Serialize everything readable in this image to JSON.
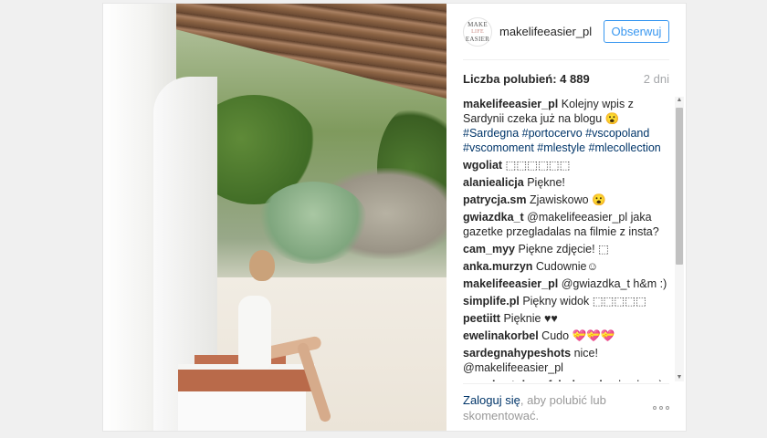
{
  "header": {
    "avatar_lines": [
      "MAKE",
      "LIFE",
      "EASIER"
    ],
    "username": "makelifeeasier_pl",
    "follow_label": "Obserwuj"
  },
  "stats": {
    "likes_label": "Liczba polubień: 4 889",
    "age": "2 dni"
  },
  "comments": [
    {
      "user": "makelifeeasier_pl",
      "text": "Kolejny wpis z Sardynii czeka już na blogu 😮 ",
      "tags": "#Sardegna #portocervo #vscopoland #vscomoment #mlestyle #mlecollection"
    },
    {
      "user": "wgoliat",
      "text": "⬚⬚⬚⬚⬚⬚"
    },
    {
      "user": "alaniealicja",
      "text": "Piękne!"
    },
    {
      "user": "patrycja.sm",
      "text": "Zjawiskowo 😮"
    },
    {
      "user": "gwiazdka_t",
      "text": "@makelifeeasier_pl jaka gazetke przegladalas na filmie z insta?"
    },
    {
      "user": "cam_myy",
      "text": "Piękne zdjęcie! ⬚"
    },
    {
      "user": "anka.murzyn",
      "text": "Cudownie☺"
    },
    {
      "user": "makelifeeasier_pl",
      "text": "@gwiazdka_t h&m :)"
    },
    {
      "user": "simplife.pl",
      "text": "Piękny widok ⬚⬚⬚⬚⬚"
    },
    {
      "user": "peetiitt",
      "text": "Pięknie ♥♥"
    },
    {
      "user": "ewelinakorbel",
      "text": "Cudo 💝💝💝"
    },
    {
      "user": "sardegnahypeshots",
      "text": "nice! @makelifeeasier_pl"
    },
    {
      "user": "muszka_tobavefabulousday",
      "text": "bosko :-)"
    }
  ],
  "footer": {
    "login_link": "Zaloguj się",
    "login_rest": ", aby polubić lub skomentować."
  }
}
